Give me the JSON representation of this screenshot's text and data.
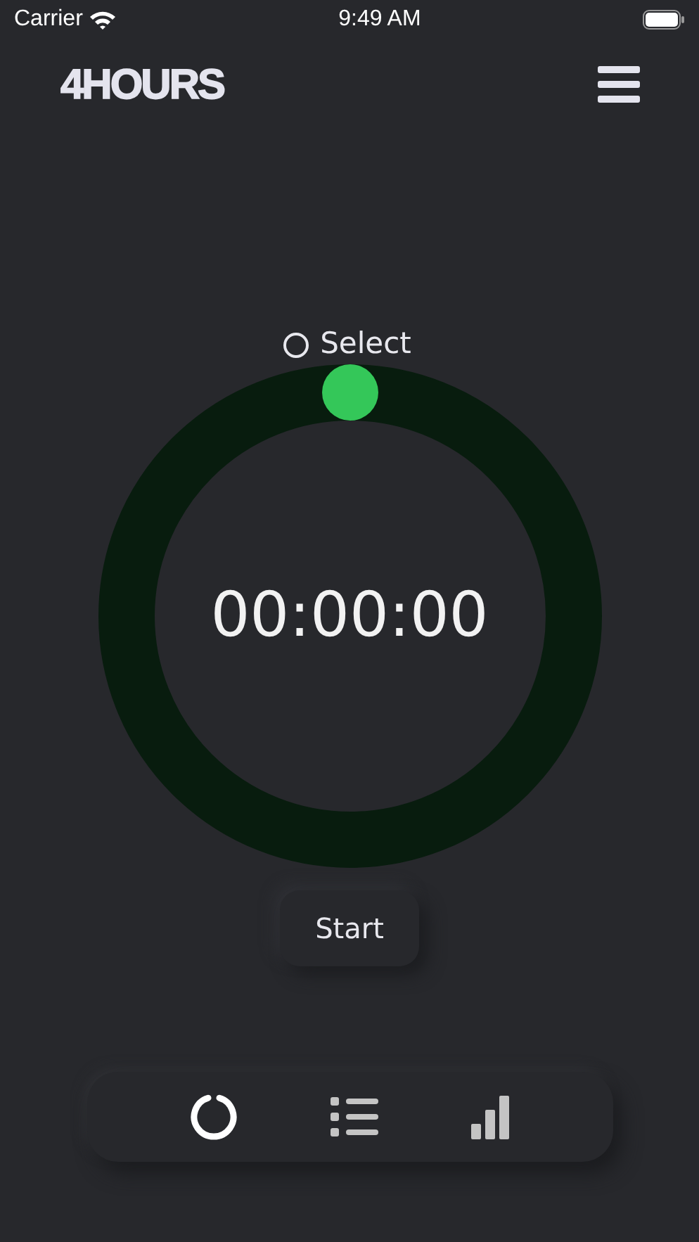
{
  "status_bar": {
    "carrier": "Carrier",
    "time": "9:49 AM"
  },
  "header": {
    "logo": "4HOURS"
  },
  "selector": {
    "label": "Select",
    "checked": false
  },
  "timer": {
    "reading": "00:00:00"
  },
  "start_button": {
    "label": "Start"
  },
  "tabs": [
    {
      "kind": "timer",
      "selected": true
    },
    {
      "kind": "list",
      "selected": false
    },
    {
      "kind": "stats",
      "selected": false
    }
  ]
}
